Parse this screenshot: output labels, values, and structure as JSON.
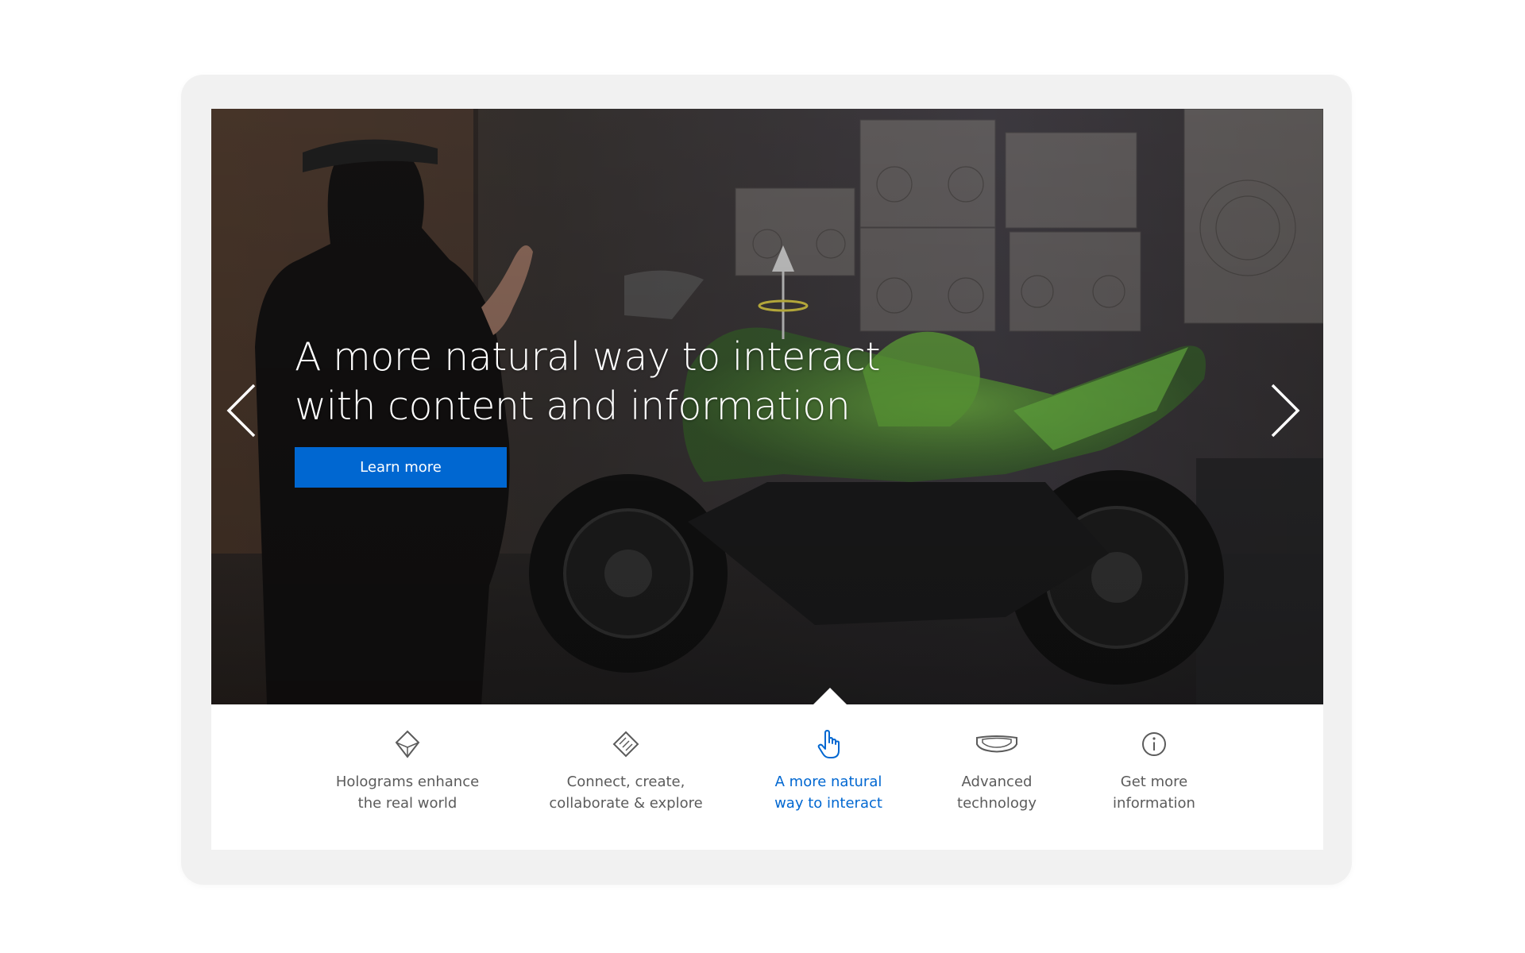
{
  "hero": {
    "title_line1": "A more natural way to interact",
    "title_line2": "with content and information",
    "cta_label": "Learn more",
    "prev_icon": "chevron-left-icon",
    "next_icon": "chevron-right-icon"
  },
  "nav": {
    "items": [
      {
        "label": "Holograms enhance\nthe real world",
        "icon": "hologram-diamond-icon",
        "active": false
      },
      {
        "label": "Connect, create,\ncollaborate & explore",
        "icon": "connect-diamond-icon",
        "active": false
      },
      {
        "label": "A more natural\nway to interact",
        "icon": "hand-pointer-icon",
        "active": true
      },
      {
        "label": "Advanced\ntechnology",
        "icon": "headset-visor-icon",
        "active": false
      },
      {
        "label": "Get more\ninformation",
        "icon": "info-circle-icon",
        "active": false
      }
    ]
  },
  "colors": {
    "accent": "#0067d1",
    "nav_text": "#5b5b5b",
    "frame": "#f1f1f1",
    "hologram_green": "#5aa83a"
  }
}
